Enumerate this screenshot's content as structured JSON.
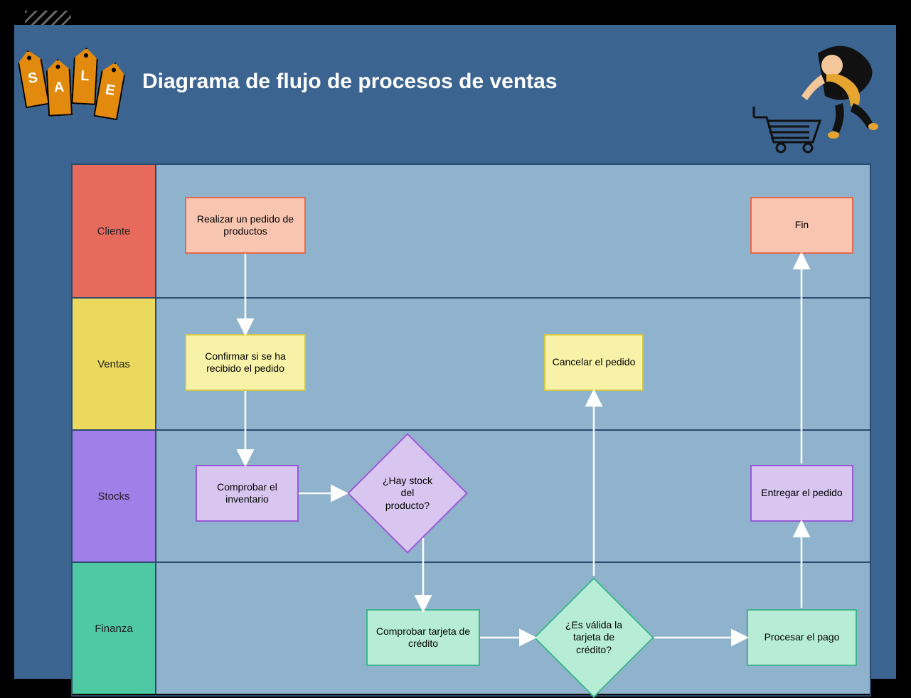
{
  "title": "Diagrama de flujo de procesos de ventas",
  "sale_letters": [
    "S",
    "A",
    "L",
    "E"
  ],
  "lanes": [
    {
      "id": "cliente",
      "label": "Cliente"
    },
    {
      "id": "ventas",
      "label": "Ventas"
    },
    {
      "id": "stocks",
      "label": "Stocks"
    },
    {
      "id": "finanza",
      "label": "Finanza"
    }
  ],
  "nodes": {
    "realizar": "Realizar un pedido de productos",
    "fin": "Fin",
    "confirmar": "Confirmar si se ha recibido el pedido",
    "cancelar": "Cancelar el pedido",
    "comprobar": "Comprobar el inventario",
    "hay_stock": "¿Hay stock del producto?",
    "entregar": "Entregar el pedido",
    "tarjeta": "Comprobar tarjeta de crédito",
    "valida": "¿Es válida la tarjeta de crédito?",
    "procesar": "Procesar el pago"
  },
  "flow_edges": [
    {
      "from": "realizar",
      "to": "confirmar"
    },
    {
      "from": "confirmar",
      "to": "comprobar"
    },
    {
      "from": "comprobar",
      "to": "hay_stock"
    },
    {
      "from": "hay_stock",
      "to": "tarjeta"
    },
    {
      "from": "tarjeta",
      "to": "valida"
    },
    {
      "from": "valida",
      "to": "cancelar"
    },
    {
      "from": "valida",
      "to": "procesar"
    },
    {
      "from": "procesar",
      "to": "entregar"
    },
    {
      "from": "entregar",
      "to": "fin"
    }
  ]
}
